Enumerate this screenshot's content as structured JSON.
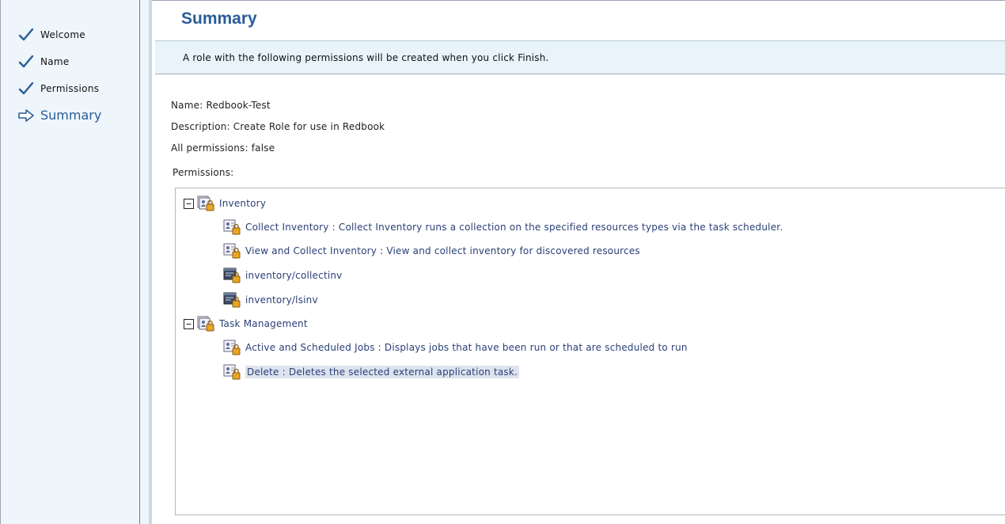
{
  "steps": [
    {
      "label": "Welcome",
      "state": "done",
      "icon": "checkmark-icon"
    },
    {
      "label": "Name",
      "state": "done",
      "icon": "checkmark-icon"
    },
    {
      "label": "Permissions",
      "state": "done",
      "icon": "checkmark-icon"
    },
    {
      "label": "Summary",
      "state": "current",
      "icon": "arrow-right-icon"
    }
  ],
  "page": {
    "title": "Summary",
    "banner": "A role with the following permissions will be created when you click Finish."
  },
  "details": {
    "name": "Name: Redbook-Test",
    "description": "Description: Create Role for use in Redbook",
    "all_permissions": "All permissions: false",
    "permissions_label": "Permissions:"
  },
  "tree": {
    "groups": [
      {
        "label": "Inventory",
        "expanded": true,
        "items": [
          {
            "label": "Collect Inventory : Collect Inventory runs a collection on the specified resources types via the task scheduler.",
            "icon": "role-permission-icon"
          },
          {
            "label": "View and Collect Inventory : View and collect inventory for discovered resources",
            "icon": "role-permission-icon"
          },
          {
            "label": "inventory/collectinv",
            "icon": "command-permission-icon"
          },
          {
            "label": "inventory/lsinv",
            "icon": "command-permission-icon"
          }
        ]
      },
      {
        "label": "Task Management",
        "expanded": true,
        "items": [
          {
            "label": "Active and Scheduled Jobs : Displays jobs that have been run or that are scheduled to run",
            "icon": "role-permission-icon"
          },
          {
            "label": "Delete : Deletes the selected external application task.",
            "icon": "role-permission-icon",
            "selected": true
          }
        ]
      }
    ],
    "toggle_symbol": "−"
  },
  "colors": {
    "accent": "#2a5c96",
    "sidebar_bg": "#eef6fb",
    "banner_bg": "#e8f3fa",
    "selection_bg": "#dde3ee",
    "link_text": "#2a3f77"
  }
}
